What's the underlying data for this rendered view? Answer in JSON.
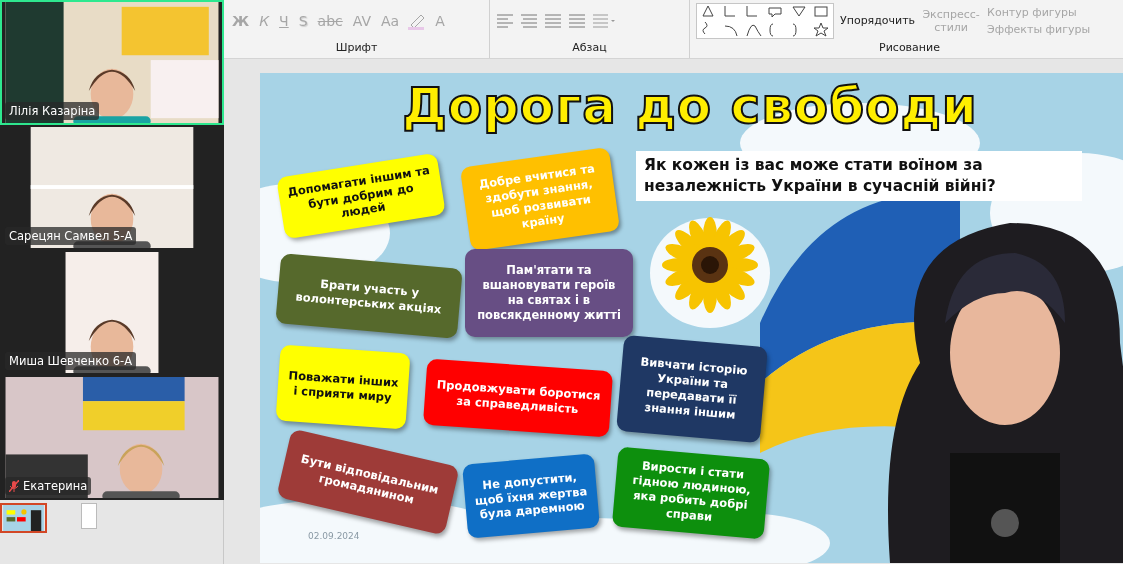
{
  "participants": [
    {
      "name": "Лілія Казаріна",
      "speaking": true,
      "muted": false,
      "kind": "wide"
    },
    {
      "name": "Сарецян Самвел 5-А",
      "speaking": false,
      "muted": false,
      "kind": "medium"
    },
    {
      "name": "Миша Шевченко 6-А",
      "speaking": false,
      "muted": false,
      "kind": "narrow"
    },
    {
      "name": "Екатерина",
      "speaking": false,
      "muted": true,
      "kind": "wide"
    }
  ],
  "ribbon": {
    "font_group": {
      "label": "Шрифт",
      "buttons": [
        {
          "kind": "bold",
          "label": "Ж",
          "disabled": true
        },
        {
          "kind": "italic",
          "label": "К",
          "disabled": true
        },
        {
          "kind": "underline",
          "label": "Ч",
          "disabled": true
        },
        {
          "kind": "shadow",
          "label": "S",
          "disabled": true
        },
        {
          "kind": "strike",
          "label": "abc",
          "disabled": true
        },
        {
          "kind": "spacing",
          "label": "AV",
          "disabled": true
        },
        {
          "kind": "case",
          "label": "Aa",
          "disabled": true
        },
        {
          "kind": "highlight",
          "disabled": true
        },
        {
          "kind": "color",
          "label": "A",
          "disabled": true
        }
      ]
    },
    "paragraph_group": {
      "label": "Абзац"
    },
    "drawing_group": {
      "label": "Рисование",
      "arrange": {
        "label": "Упорядочить",
        "disabled": false
      },
      "quick_styles": {
        "label": "Экспресс-стили",
        "disabled": true
      },
      "outline": {
        "label": "Контур фигуры",
        "disabled": true
      },
      "effects": {
        "label": "Эффекты фигуры",
        "disabled": true
      }
    }
  },
  "slide": {
    "title": "Дорога до свободи",
    "question": "Як кожен із вас може стати воїном за незалежність України в сучасній війні?",
    "date": "02.09.2024",
    "cards": [
      {
        "text": "Допомагати іншим та бути добрим до людей",
        "color": "#ffff00"
      },
      {
        "text": "Добре вчитися та здобути знання, щоб розвивати країну",
        "color": "#ffc000"
      },
      {
        "text": "Брати участь у волонтерських акціях",
        "color": "#56692c"
      },
      {
        "text": "Пам'ятати та вшановувати героїв на святах і в повсякденному житті",
        "color": "#674e84"
      },
      {
        "text": "Поважати інших і сприяти миру",
        "color": "#ffff00"
      },
      {
        "text": "Продовжувати боротися за справедливість",
        "color": "#ff0000"
      },
      {
        "text": "Вивчати історію України та передавати її знання іншим",
        "color": "#1f3864"
      },
      {
        "text": "Бути відповідальним громадянином",
        "color": "#9e3b38"
      },
      {
        "text": "Не допустити, щоб їхня жертва була даремною",
        "color": "#0f6fc6"
      },
      {
        "text": "Вирости і стати гідною людиною, яка робить добрі справи",
        "color": "#0d8f0d"
      }
    ]
  }
}
